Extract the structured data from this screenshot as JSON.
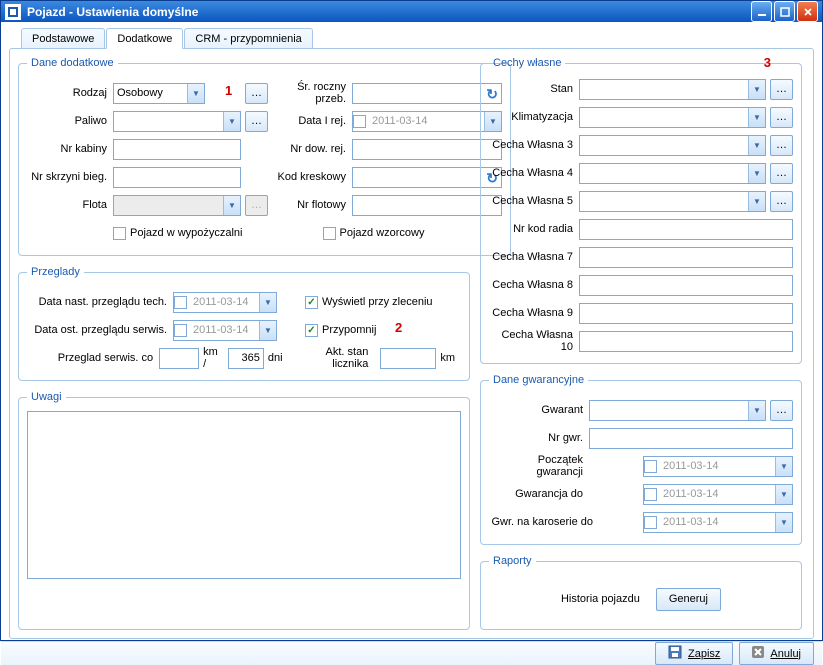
{
  "window": {
    "title": "Pojazd - Ustawienia domyślne"
  },
  "tabs": [
    "Podstawowe",
    "Dodatkowe",
    "CRM - przypomnienia"
  ],
  "annotations": {
    "a1": "1",
    "a2": "2",
    "a3": "3"
  },
  "dane_dodatkowe": {
    "legend": "Dane dodatkowe",
    "rodzaj_label": "Rodzaj",
    "rodzaj_value": "Osobowy",
    "paliwo_label": "Paliwo",
    "paliwo_value": "",
    "nrkabiny_label": "Nr kabiny",
    "nrkabiny_value": "",
    "nrskrzyni_label": "Nr skrzyni bieg.",
    "nrskrzyni_value": "",
    "flota_label": "Flota",
    "flota_value": "",
    "wypoz_label": "Pojazd w wypożyczalni",
    "sr_roczny_label": "Śr. roczny przeb.",
    "sr_roczny_value": "",
    "data1rej_label": "Data I rej.",
    "data1rej_value": "2011-03-14",
    "nrdow_label": "Nr dow. rej.",
    "nrdow_value": "",
    "kod_kreskowy_label": "Kod kreskowy",
    "kod_kreskowy_value": "",
    "nrflotowy_label": "Nr flotowy",
    "nrflotowy_value": "",
    "wzorcowy_label": "Pojazd wzorcowy"
  },
  "przeglady": {
    "legend": "Przeglady",
    "tech_label": "Data nast. przeglądu tech.",
    "tech_value": "2011-03-14",
    "serwis_label": "Data ost. przeglądu serwis.",
    "serwis_value": "2011-03-14",
    "wyswietl_label": "Wyświetl przy zleceniu",
    "przypomnij_label": "Przypomnij",
    "co_label": "Przeglad serwis. co",
    "co_value": "",
    "co_km": "km /",
    "co_dni_value": "365",
    "co_dni": "dni",
    "akt_label": "Akt. stan licznika",
    "akt_value": "",
    "akt_unit": "km"
  },
  "uwagi": {
    "legend": "Uwagi",
    "value": ""
  },
  "cechy": {
    "legend": "Cechy własne",
    "rows": [
      {
        "label": "Stan",
        "combo": true,
        "ellipsis": true
      },
      {
        "label": "Klimatyzacja",
        "combo": true,
        "ellipsis": true
      },
      {
        "label": "Cecha Własna 3",
        "combo": true,
        "ellipsis": true
      },
      {
        "label": "Cecha Własna 4",
        "combo": true,
        "ellipsis": true
      },
      {
        "label": "Cecha Własna 5",
        "combo": true,
        "ellipsis": true
      },
      {
        "label": "Nr kod radia",
        "combo": false,
        "ellipsis": false
      },
      {
        "label": "Cecha Własna 7",
        "combo": false,
        "ellipsis": false
      },
      {
        "label": "Cecha Własna 8",
        "combo": false,
        "ellipsis": false
      },
      {
        "label": "Cecha Własna 9",
        "combo": false,
        "ellipsis": false
      },
      {
        "label": "Cecha Własna 10",
        "combo": false,
        "ellipsis": false
      }
    ]
  },
  "gwar": {
    "legend": "Dane gwarancyjne",
    "gwarant_label": "Gwarant",
    "gwarant_value": "",
    "nrgwr_label": "Nr gwr.",
    "nrgwr_value": "",
    "poczatek_label": "Początek gwarancji",
    "poczatek_value": "2011-03-14",
    "do_label": "Gwarancja do",
    "do_value": "2011-03-14",
    "karoserie_label": "Gwr. na karoserie do",
    "karoserie_value": "2011-03-14"
  },
  "raporty": {
    "legend": "Raporty",
    "historia_label": "Historia pojazdu",
    "generuj_label": "Generuj"
  },
  "footer": {
    "zapisz": "Zapisz",
    "anuluj": "Anuluj"
  }
}
